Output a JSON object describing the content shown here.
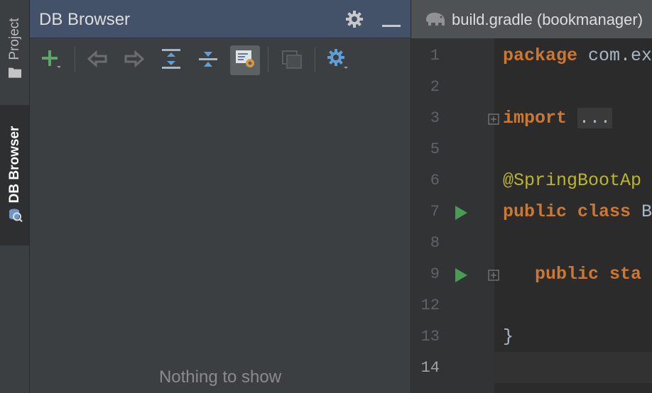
{
  "sidebar": {
    "project_label": "Project",
    "db_browser_label": "DB Browser"
  },
  "panel": {
    "title": "DB Browser",
    "empty_text": "Nothing to show",
    "toolbar": [
      {
        "icon": "add-icon"
      },
      {
        "icon": "back-icon"
      },
      {
        "icon": "forward-icon"
      },
      {
        "icon": "expand-all-icon"
      },
      {
        "icon": "collapse-all-icon"
      },
      {
        "icon": "autoscroll-icon"
      },
      {
        "icon": "sessions-icon"
      },
      {
        "icon": "settings-icon"
      }
    ]
  },
  "editor": {
    "tab_label": "build.gradle (bookmanager)",
    "lines": [
      {
        "no": "1",
        "parts": [
          {
            "t": "package ",
            "c": "kw"
          },
          {
            "t": "com.ex",
            "c": "plain"
          }
        ]
      },
      {
        "no": "2",
        "parts": []
      },
      {
        "no": "3",
        "parts": [
          {
            "t": "import ",
            "c": "kw"
          },
          {
            "t": "...",
            "c": "folded"
          }
        ]
      },
      {
        "no": "5",
        "parts": []
      },
      {
        "no": "6",
        "parts": [
          {
            "t": "@SpringBootAp",
            "c": "anno"
          }
        ]
      },
      {
        "no": "7",
        "parts": [
          {
            "t": "public class ",
            "c": "kw"
          },
          {
            "t": "B",
            "c": "plain"
          }
        ]
      },
      {
        "no": "8",
        "parts": []
      },
      {
        "no": "9",
        "parts": [
          {
            "t": "   public sta",
            "c": "kw"
          }
        ]
      },
      {
        "no": "12",
        "parts": []
      },
      {
        "no": "13",
        "parts": [
          {
            "t": "}",
            "c": "plain"
          }
        ]
      },
      {
        "no": "14",
        "parts": []
      }
    ]
  }
}
